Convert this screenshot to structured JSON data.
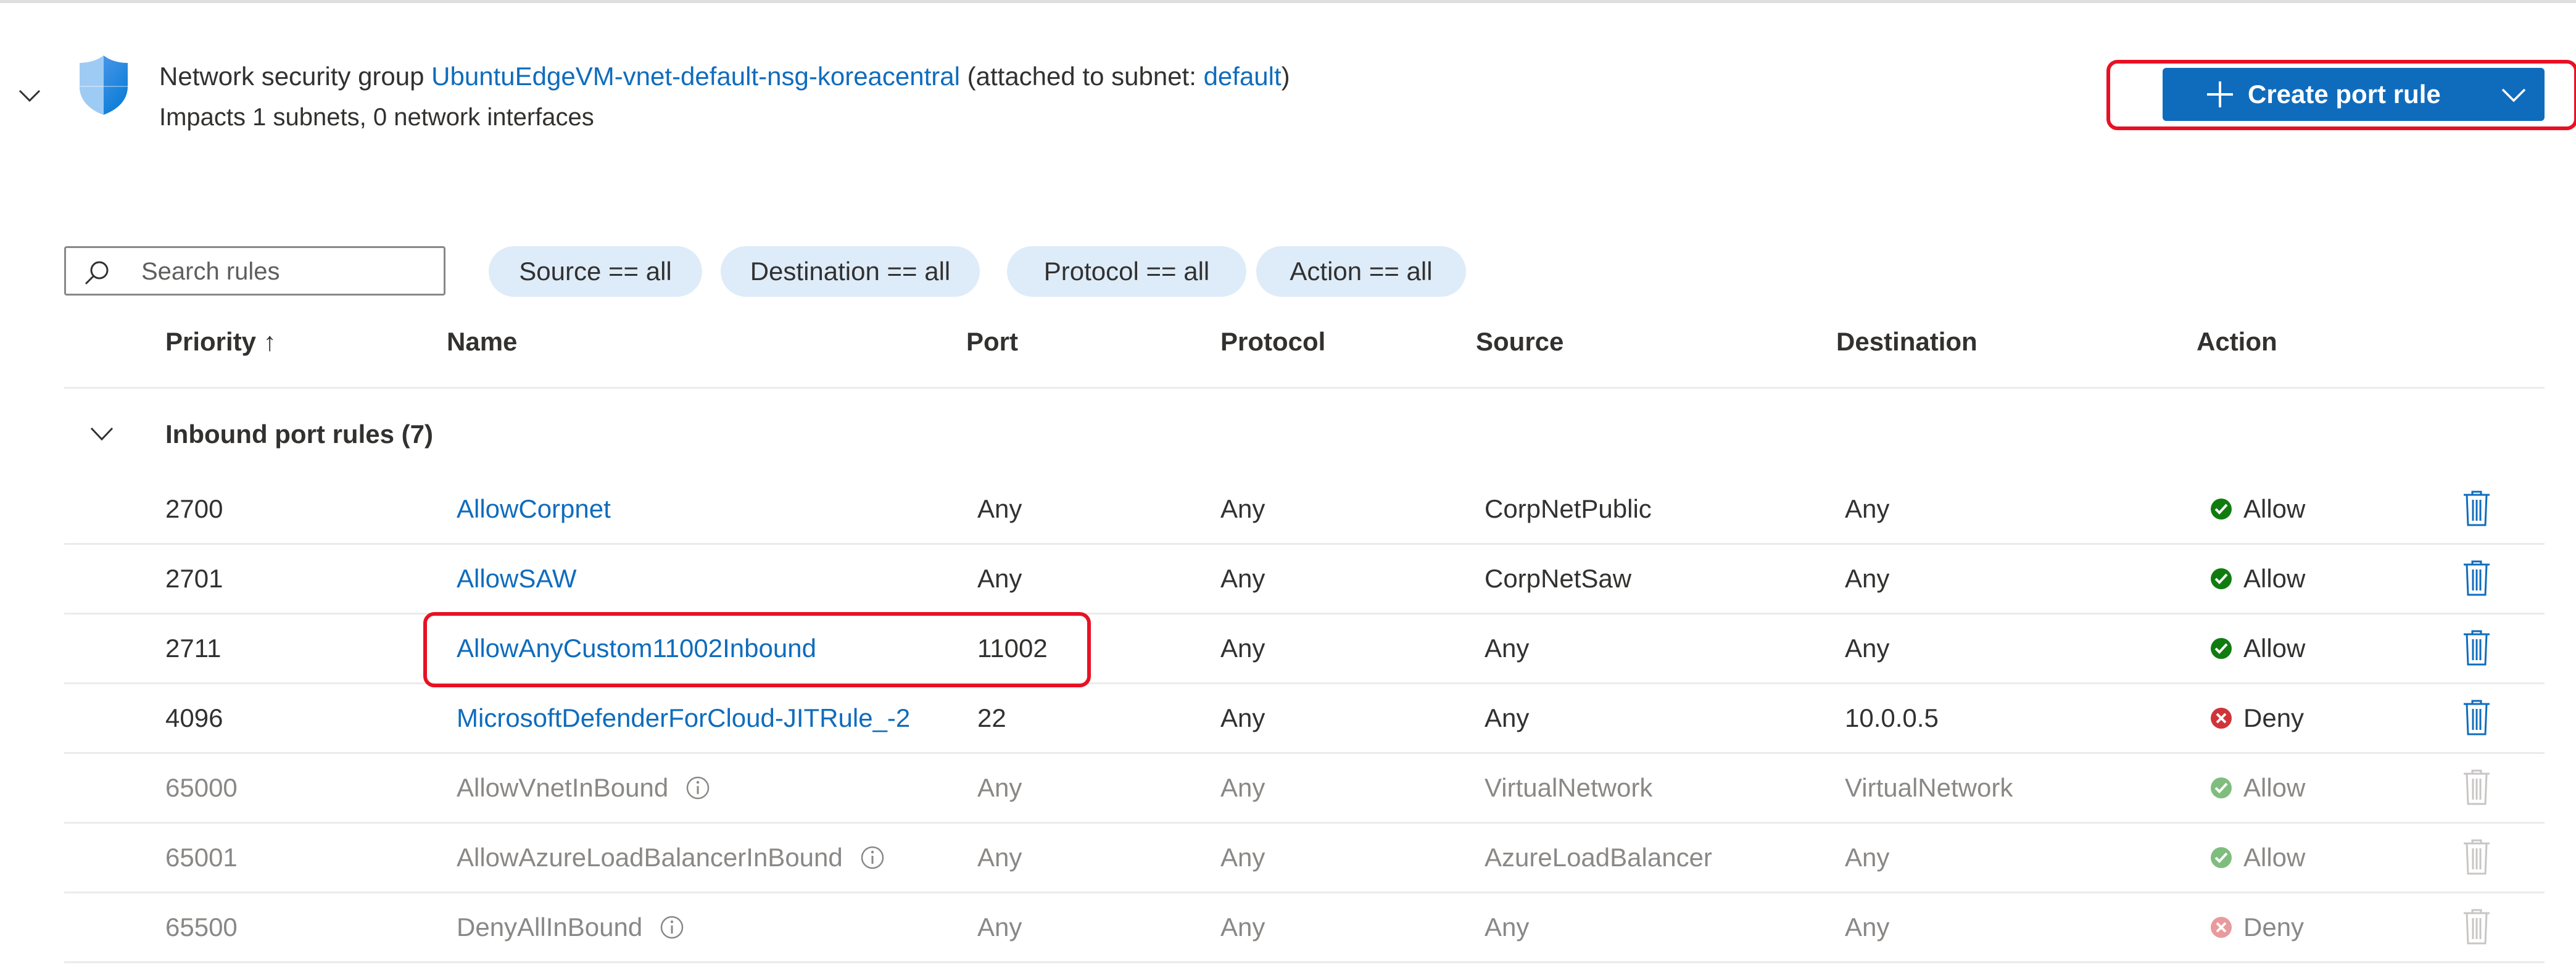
{
  "nsg": {
    "prefix": "Network security group",
    "name": "UbuntuEdgeVM-vnet-default-nsg-koreacentral",
    "attached_prefix": "(attached to subnet: ",
    "subnet": "default",
    "attached_suffix": ")",
    "impacts": "Impacts 1 subnets, 0 network interfaces",
    "icon": "shield-icon"
  },
  "create_button": {
    "label": "Create port rule",
    "color": "#0f6cbd"
  },
  "search": {
    "placeholder": "Search rules",
    "value": ""
  },
  "filters": [
    "Source == all",
    "Destination == all",
    "Protocol == all",
    "Action == all"
  ],
  "columns": {
    "priority": "Priority ↑",
    "name": "Name",
    "port": "Port",
    "protocol": "Protocol",
    "source": "Source",
    "destination": "Destination",
    "action": "Action"
  },
  "group": {
    "label": "Inbound port rules (7)"
  },
  "rules": [
    {
      "priority": "2700",
      "name": "AllowCorpnet",
      "port": "Any",
      "protocol": "Any",
      "source": "CorpNetPublic",
      "destination": "Any",
      "action": "Allow"
    },
    {
      "priority": "2701",
      "name": "AllowSAW",
      "port": "Any",
      "protocol": "Any",
      "source": "CorpNetSaw",
      "destination": "Any",
      "action": "Allow"
    },
    {
      "priority": "2711",
      "name": "AllowAnyCustom11002Inbound",
      "port": "11002",
      "protocol": "Any",
      "source": "Any",
      "destination": "Any",
      "action": "Allow"
    },
    {
      "priority": "4096",
      "name": "MicrosoftDefenderForCloud-JITRule_-2",
      "port": "22",
      "protocol": "Any",
      "source": "Any",
      "destination": "10.0.0.5",
      "action": "Deny"
    },
    {
      "priority": "65000",
      "name": "AllowVnetInBound",
      "port": "Any",
      "protocol": "Any",
      "source": "VirtualNetwork",
      "destination": "VirtualNetwork",
      "action": "Allow"
    },
    {
      "priority": "65001",
      "name": "AllowAzureLoadBalancerInBound",
      "port": "Any",
      "protocol": "Any",
      "source": "AzureLoadBalancer",
      "destination": "Any",
      "action": "Allow"
    },
    {
      "priority": "65500",
      "name": "DenyAllInBound",
      "port": "Any",
      "protocol": "Any",
      "source": "Any",
      "destination": "Any",
      "action": "Deny"
    }
  ],
  "colors": {
    "link": "#0f6cbd",
    "allow": "#107c10",
    "deny": "#d13438",
    "highlight": "#e81123"
  }
}
